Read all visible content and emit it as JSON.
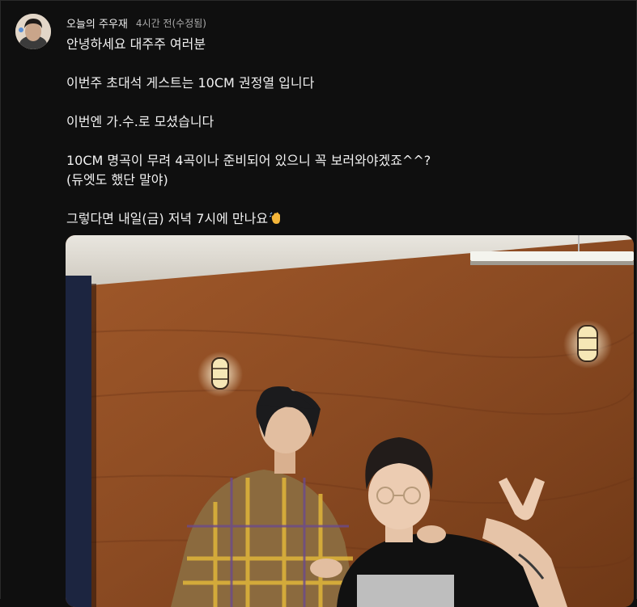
{
  "post": {
    "author": "오늘의 주우재",
    "time": "4시간 전(수정됨)",
    "lines": [
      "안녕하세요 대주주 여러분",
      "이번주 초대석 게스트는 10CM 권정열 입니다",
      "이번엔 가.수.로 모셨습니다",
      "10CM 명곡이 무려 4곡이나 준비되어 있으니 꼭 보러와야겠죠^^?",
      "(듀엣도 했단 말야)",
      "그렇다면 내일(금) 저녁 7시에 만나요"
    ],
    "emoji": "waving-hand-emoji"
  },
  "colors": {
    "background": "#0f0f0f",
    "text": "#f1f1f1",
    "meta": "#aaaaaa",
    "wall": "#8a4a22"
  }
}
